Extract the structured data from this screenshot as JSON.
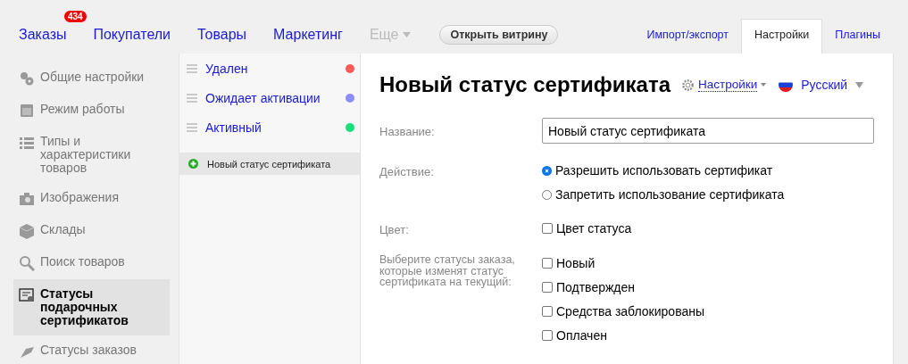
{
  "nav": {
    "items": [
      {
        "label": "Заказы",
        "badge": "434",
        "disabled": false
      },
      {
        "label": "Покупатели",
        "disabled": false
      },
      {
        "label": "Товары",
        "disabled": false
      },
      {
        "label": "Маркетинг",
        "disabled": false
      },
      {
        "label": "Еще",
        "disabled": true
      }
    ],
    "storefront_button": "Открыть витрину",
    "tabs": [
      {
        "label": "Импорт/экспорт",
        "selected": false
      },
      {
        "label": "Настройки",
        "selected": true
      },
      {
        "label": "Плагины",
        "selected": false
      }
    ]
  },
  "sidebar": {
    "items": [
      {
        "label": "Общие настройки",
        "selected": false
      },
      {
        "label": "Режим работы",
        "selected": false
      },
      {
        "label": "Типы и характеристики товаров",
        "selected": false
      },
      {
        "label": "Изображения",
        "selected": false
      },
      {
        "label": "Склады",
        "selected": false
      },
      {
        "label": "Поиск товаров",
        "selected": false
      },
      {
        "label": "Статусы подарочных сертификатов",
        "selected": true
      },
      {
        "label": "Статусы заказов",
        "selected": false
      }
    ]
  },
  "statuses": {
    "items": [
      {
        "label": "Удален",
        "color": "#ff5a5a"
      },
      {
        "label": "Ожидает активации",
        "color": "#8c8cff"
      },
      {
        "label": "Активный",
        "color": "#17e07a"
      }
    ],
    "new_item": {
      "label": "Новый статус сертификата",
      "selected": true
    }
  },
  "form": {
    "title": "Новый статус сертификата",
    "settings_link": "Настройки",
    "language": "Русский",
    "name_label": "Название:",
    "name_value": "Новый статус сертификата",
    "action_label": "Действие:",
    "actions": [
      {
        "label": "Разрешить использовать сертификат",
        "selected": true
      },
      {
        "label": "Запретить использование сертификата",
        "selected": false
      }
    ],
    "color_label": "Цвет:",
    "color_checkbox": {
      "label": "Цвет статуса",
      "checked": false
    },
    "orders_label": "Выберите статусы заказа, которые изменят статус сертификата на текущий:",
    "order_statuses": [
      {
        "label": "Новый",
        "checked": false
      },
      {
        "label": "Подтвержден",
        "checked": false
      },
      {
        "label": "Средства заблокированы",
        "checked": false
      },
      {
        "label": "Оплачен",
        "checked": false
      }
    ]
  }
}
